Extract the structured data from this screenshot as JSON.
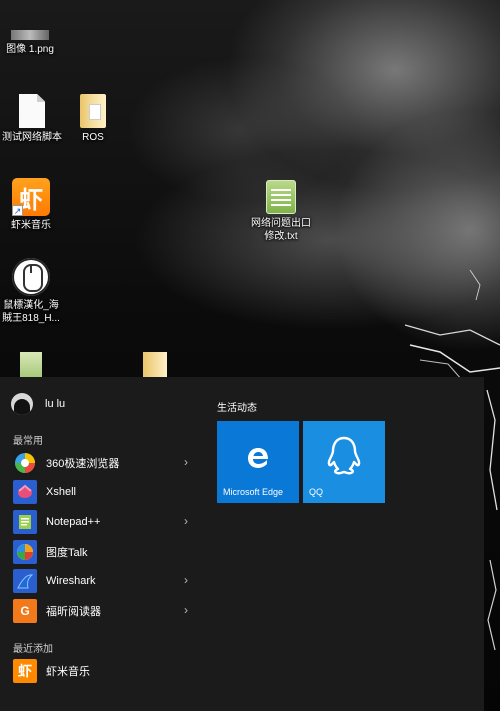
{
  "desktop": {
    "icons": [
      {
        "label": "图像 1.png",
        "icon": "image-file-icon"
      },
      {
        "label": "测试网络脚本",
        "icon": "document-file-icon"
      },
      {
        "label": "ROS",
        "icon": "folder-icon"
      },
      {
        "label": "虾米音乐",
        "icon": "xiami-music-icon",
        "glyph": "虾"
      },
      {
        "label": "网络问题出口\n修改.txt",
        "icon": "text-file-icon"
      },
      {
        "label": "鼠標漢化_海\n賊王818_H...",
        "icon": "mouse-app-icon"
      }
    ]
  },
  "start_menu": {
    "user": {
      "name": "lu lu"
    },
    "most_used_label": "最常用",
    "recently_added_label": "最近添加",
    "apps": [
      {
        "label": "360极速浏览器",
        "icon": "browser-360-icon",
        "has_submenu": true,
        "color": "#3b6fd8"
      },
      {
        "label": "Xshell",
        "icon": "xshell-icon",
        "has_submenu": false,
        "color": "#2b5fd0"
      },
      {
        "label": "Notepad++",
        "icon": "notepad-plus-icon",
        "has_submenu": true,
        "color": "#2b5fd0"
      },
      {
        "label": "图度Talk",
        "icon": "tudu-talk-icon",
        "has_submenu": false,
        "color": "#2b5fd0"
      },
      {
        "label": "Wireshark",
        "icon": "wireshark-icon",
        "has_submenu": true,
        "color": "#2b5fd0"
      },
      {
        "label": "福昕阅读器",
        "icon": "foxit-reader-icon",
        "has_submenu": true,
        "color": "#f27a1a"
      }
    ],
    "recent": [
      {
        "label": "虾米音乐",
        "icon": "xiami-music-icon",
        "glyph": "虾"
      }
    ],
    "tiles_heading": "生活动态",
    "tiles": [
      {
        "label": "Microsoft Edge",
        "icon": "edge-icon",
        "color": "#0a78d7"
      },
      {
        "label": "QQ",
        "icon": "qq-penguin-icon",
        "color": "#1a8ee1"
      }
    ],
    "chevron_glyph": "›"
  }
}
